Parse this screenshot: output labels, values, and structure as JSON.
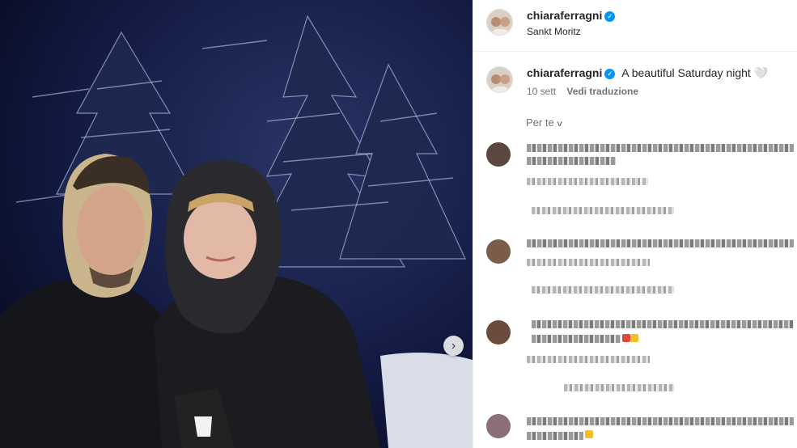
{
  "post": {
    "username": "chiaraferragni",
    "location": "Sankt Moritz",
    "caption_text": "A beautiful Saturday night 🤍",
    "time_ago": "10 sett",
    "translate_label": "Vedi traduzione",
    "sort_label": "Per te"
  },
  "colors": {
    "verified": "#0095f6",
    "meta_text": "#737373",
    "divider": "#efefef"
  },
  "icons": [
    "verified-badge-icon",
    "chevron-right-icon",
    "chevron-down-icon"
  ]
}
